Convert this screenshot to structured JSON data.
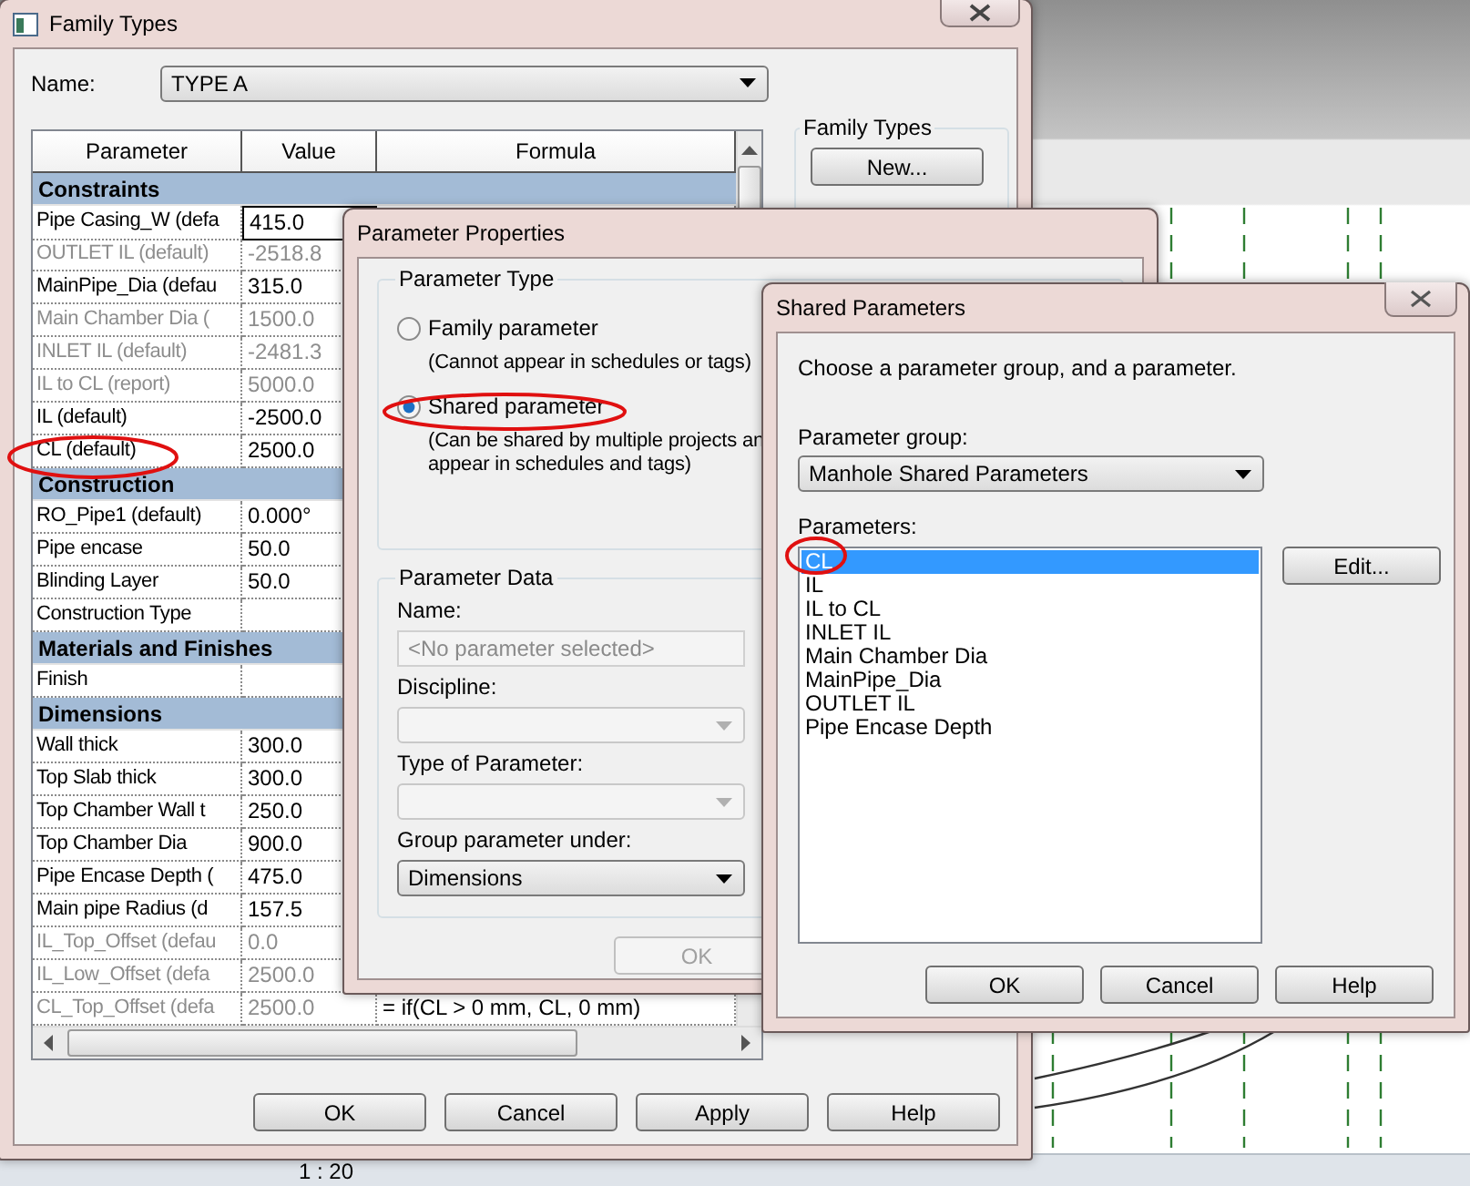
{
  "family_types": {
    "title": "Family Types",
    "name_label": "Name:",
    "name_value": "TYPE A",
    "columns": [
      "Parameter",
      "Value",
      "Formula"
    ],
    "groups": [
      {
        "name": "Constraints",
        "rows": [
          {
            "parameter": "Pipe Casing_W (defa",
            "value": "415.0",
            "disabled": false,
            "editing": true
          },
          {
            "parameter": "OUTLET IL (default)",
            "value": "-2518.8",
            "disabled": true
          },
          {
            "parameter": "MainPipe_Dia (defau",
            "value": "315.0",
            "disabled": false
          },
          {
            "parameter": "Main Chamber Dia (",
            "value": "1500.0",
            "disabled": true
          },
          {
            "parameter": "INLET IL (default)",
            "value": "-2481.3",
            "disabled": true
          },
          {
            "parameter": "IL to CL (report)",
            "value": "5000.0",
            "disabled": true
          },
          {
            "parameter": "IL (default)",
            "value": "-2500.0",
            "disabled": false
          },
          {
            "parameter": "CL (default)",
            "value": "2500.0",
            "disabled": false
          }
        ]
      },
      {
        "name": "Construction",
        "rows": [
          {
            "parameter": "RO_Pipe1 (default)",
            "value": "0.000°",
            "disabled": false
          },
          {
            "parameter": "Pipe encase",
            "value": "50.0",
            "disabled": false
          },
          {
            "parameter": "Blinding Layer",
            "value": "50.0",
            "disabled": false
          },
          {
            "parameter": "Construction Type",
            "value": "",
            "disabled": false
          }
        ]
      },
      {
        "name": "Materials and Finishes",
        "rows": [
          {
            "parameter": "Finish",
            "value": "",
            "disabled": false
          }
        ]
      },
      {
        "name": "Dimensions",
        "rows": [
          {
            "parameter": "Wall thick",
            "value": "300.0",
            "disabled": false
          },
          {
            "parameter": "Top Slab thick",
            "value": "300.0",
            "disabled": false
          },
          {
            "parameter": "Top Chamber Wall t",
            "value": "250.0",
            "disabled": false
          },
          {
            "parameter": "Top Chamber Dia",
            "value": "900.0",
            "disabled": false
          },
          {
            "parameter": "Pipe Encase Depth (",
            "value": "475.0",
            "disabled": false
          },
          {
            "parameter": "Main pipe Radius (d",
            "value": "157.5",
            "disabled": false
          },
          {
            "parameter": "IL_Top_Offset (defau",
            "value": "0.0",
            "disabled": true
          },
          {
            "parameter": "IL_Low_Offset (defa",
            "value": "2500.0",
            "disabled": true
          },
          {
            "parameter": "CL_Top_Offset (defa",
            "value": "2500.0",
            "disabled": true,
            "formula": "= if(CL > 0 mm, CL, 0 mm)"
          }
        ]
      }
    ],
    "side_group": {
      "label": "Family Types",
      "buttons": [
        "New..."
      ]
    },
    "buttons": [
      "OK",
      "Cancel",
      "Apply",
      "Help"
    ]
  },
  "parameter_properties": {
    "title": "Parameter Properties",
    "parameter_type": {
      "label": "Parameter Type",
      "options": [
        {
          "label": "Family parameter",
          "description": [
            "(Cannot appear in schedules or tags)"
          ],
          "selected": false
        },
        {
          "label": "Shared parameter",
          "description": [
            "(Can be shared by multiple projects an",
            "appear in schedules and tags)"
          ],
          "selected": true
        }
      ]
    },
    "parameter_data": {
      "label": "Parameter Data",
      "fields": [
        {
          "kind": "text",
          "label": "Name:",
          "placeholder": "<No parameter selected>",
          "disabled": true
        },
        {
          "kind": "dropdown",
          "label": "Discipline:",
          "disabled": true
        },
        {
          "kind": "dropdown",
          "label": "Type of Parameter:",
          "disabled": true
        },
        {
          "kind": "dropdown",
          "label": "Group parameter under:",
          "value": "Dimensions",
          "disabled": false
        }
      ]
    },
    "ok_button": {
      "label": "OK",
      "disabled": true
    }
  },
  "shared_parameters": {
    "title": "Shared Parameters",
    "instruction": "Choose a parameter group, and a parameter.",
    "group_label": "Parameter group:",
    "group_value": "Manhole Shared Parameters",
    "parameters_label": "Parameters:",
    "parameters": [
      {
        "label": "CL",
        "selected": true
      },
      {
        "label": "IL",
        "selected": false
      },
      {
        "label": "IL to CL",
        "selected": false
      },
      {
        "label": "INLET IL",
        "selected": false
      },
      {
        "label": "Main Chamber Dia",
        "selected": false
      },
      {
        "label": "MainPipe_Dia",
        "selected": false
      },
      {
        "label": "OUTLET IL",
        "selected": false
      },
      {
        "label": "Pipe Encase Depth",
        "selected": false
      }
    ],
    "edit_button": "Edit...",
    "buttons": [
      "OK",
      "Cancel",
      "Help"
    ]
  },
  "status_bar": {
    "scale": "1 : 20"
  }
}
